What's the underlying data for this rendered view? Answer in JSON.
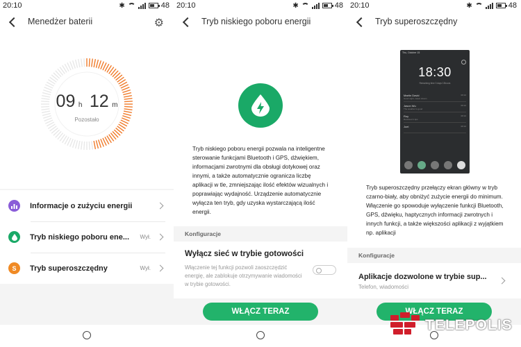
{
  "status": {
    "time": "20:10",
    "battery": "48"
  },
  "screens": {
    "battery_manager": {
      "title": "Menedżer baterii",
      "hours": "09",
      "hours_unit": "h",
      "minutes": "12",
      "minutes_unit": "m",
      "remaining_label": "Pozostało",
      "items": [
        {
          "label": "Informacje o zużyciu energii",
          "value": "",
          "icon": "chart-icon",
          "color": "#8a5cd8"
        },
        {
          "label": "Tryb niskiego poboru ene...",
          "value": "Wył.",
          "icon": "drop-icon",
          "color": "#1aa967"
        },
        {
          "label": "Tryb superoszczędny",
          "value": "Wył.",
          "icon": "s-icon",
          "icon_text": "S",
          "color": "#f08a24"
        }
      ]
    },
    "low_power": {
      "title": "Tryb niskiego poboru energii",
      "description": "Tryb niskiego poboru energii pozwala na inteligentne sterowanie funkcjami Bluetooth i GPS, dźwiękiem, informacjami zwrotnymi dla obsługi dotykowej oraz innymi, a także automatycznie ogranicza liczbę aplikacji w tle, zmniejszając ilość efektów wizualnych i poprawiając wydajność. Urządzenie automatycznie wyłącza ten tryb, gdy uzyska wystarczającą ilość energii.",
      "config_label": "Konfiguracje",
      "setting_title": "Wyłącz sieć w trybie gotowości",
      "setting_desc": "Włączenie tej funkcji pozwoli zaoszczędzić energię, ale zablokuje otrzymywanie wiadomości w trybie gotowości.",
      "button": "WŁĄCZ TERAZ"
    },
    "super_saver": {
      "title": "Tryb superoszczędny",
      "phone": {
        "date": "Thu, October 15",
        "clock": "18:30",
        "remaining": "Remaining time 3 days 13hours",
        "contacts": [
          {
            "name": "Martin David",
            "msg": "Good night, sweet dream",
            "time": "08:10"
          },
          {
            "name": "Jason Wu",
            "msg": "The weather is good",
            "time": "08:10"
          },
          {
            "name": "Roy",
            "msg": "Received 1 tips",
            "time": "08:10"
          },
          {
            "name": "Joel",
            "msg": "",
            "time": "08:10"
          }
        ]
      },
      "description": "Tryb superoszczędny przełączy ekran główny w tryb czarno-biały, aby obniżyć zużycie energii do minimum. Włączenie go spowoduje wyłączenie funkcji Bluetooth, GPS, dźwięku, haptycznych informacji zwrotnych i innych funkcji, a także większości aplikacji z wyjątkiem np. aplikacji",
      "config_label": "Konfiguracje",
      "app_title": "Aplikacje dozwolone w trybie sup...",
      "app_sub": "Telefon, wiadomości",
      "button": "WŁĄCZ TERAZ"
    }
  },
  "watermark": "TELEPOLIS",
  "colors": {
    "accent_green": "#22b36b",
    "gauge_orange": "#f07b2a"
  }
}
